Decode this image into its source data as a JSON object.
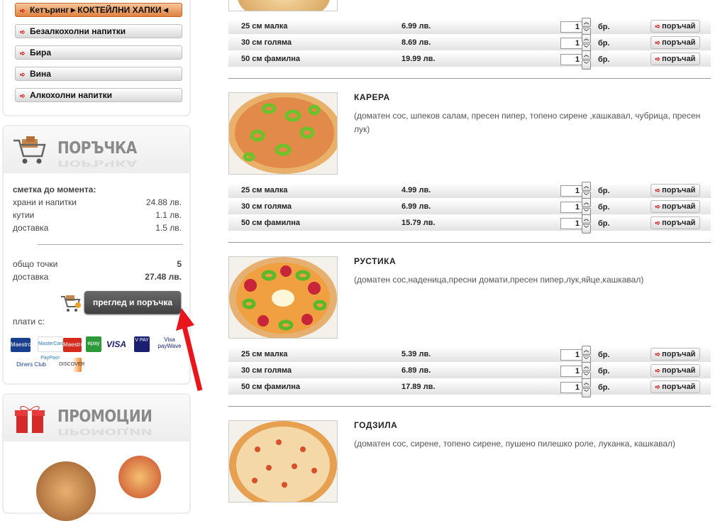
{
  "sidebar": {
    "categories": [
      {
        "label": "Кетъринг►КОКТЕЙЛНИ ХАПКИ◄"
      },
      {
        "label": "Безалкохолни напитки"
      },
      {
        "label": "Бира"
      },
      {
        "label": "Вина"
      },
      {
        "label": "Алкохолни напитки"
      }
    ]
  },
  "order": {
    "title": "ПОРЪЧКА",
    "subtotal_label": "сметка до момента:",
    "lines": [
      {
        "label": "храни и напитки",
        "value": "24.88 лв."
      },
      {
        "label": "кутии",
        "value": "1.1 лв."
      },
      {
        "label": "доставка",
        "value": "1.5 лв."
      }
    ],
    "points_label": "общо точки",
    "points_value": "5",
    "delivery_label": "доставка",
    "delivery_value": "27.48 лв.",
    "review_button": "преглед и поръчка",
    "pay_with": "плати с:"
  },
  "payments": {
    "maestro": "Maestro",
    "paypass": "MasterCard PayPass",
    "mastercard": "Maestro",
    "epay": "epay",
    "visa": "VISA",
    "vpay": "V PAY",
    "visa_paywave": "Visa payWave",
    "diners": "Diners Club",
    "discover": "DISCOVER"
  },
  "promo": {
    "title": "ПРОМОЦИИ"
  },
  "products": [
    {
      "name": "",
      "description": "",
      "sizes": [
        {
          "size": "25 см малка",
          "price": "6.99 лв.",
          "qty": "1"
        },
        {
          "size": "30 см голяма",
          "price": "8.69 лв.",
          "qty": "1"
        },
        {
          "size": "50 см фамилна",
          "price": "19.99 лв.",
          "qty": "1"
        }
      ]
    },
    {
      "name": "КАРЕРА",
      "description": "(доматен сос, шпеков салам, пресен пипер, топено сирене ,кашкавал, чубрица, пресен лук)",
      "sizes": [
        {
          "size": "25 см малка",
          "price": "4.99 лв.",
          "qty": "1"
        },
        {
          "size": "30 см голяма",
          "price": "6.99 лв.",
          "qty": "1"
        },
        {
          "size": "50 см фамилна",
          "price": "15.79 лв.",
          "qty": "1"
        }
      ]
    },
    {
      "name": "РУСТИКА",
      "description": "(доматен сос,наденица,пресни домати,пресен пипер,лук,яйце,кашкавал)",
      "sizes": [
        {
          "size": "25 см малка",
          "price": "5.39 лв.",
          "qty": "1"
        },
        {
          "size": "30 см голяма",
          "price": "6.89 лв.",
          "qty": "1"
        },
        {
          "size": "50 см фамилна",
          "price": "17.89 лв.",
          "qty": "1"
        }
      ]
    },
    {
      "name": "ГОДЗИЛА",
      "description": "(доматен сос, сирене, топено сирене, пушено пилешко роле, луканка, кашкавал)",
      "sizes": []
    }
  ],
  "labels": {
    "unit": "бр.",
    "order_button": "поръчай"
  }
}
